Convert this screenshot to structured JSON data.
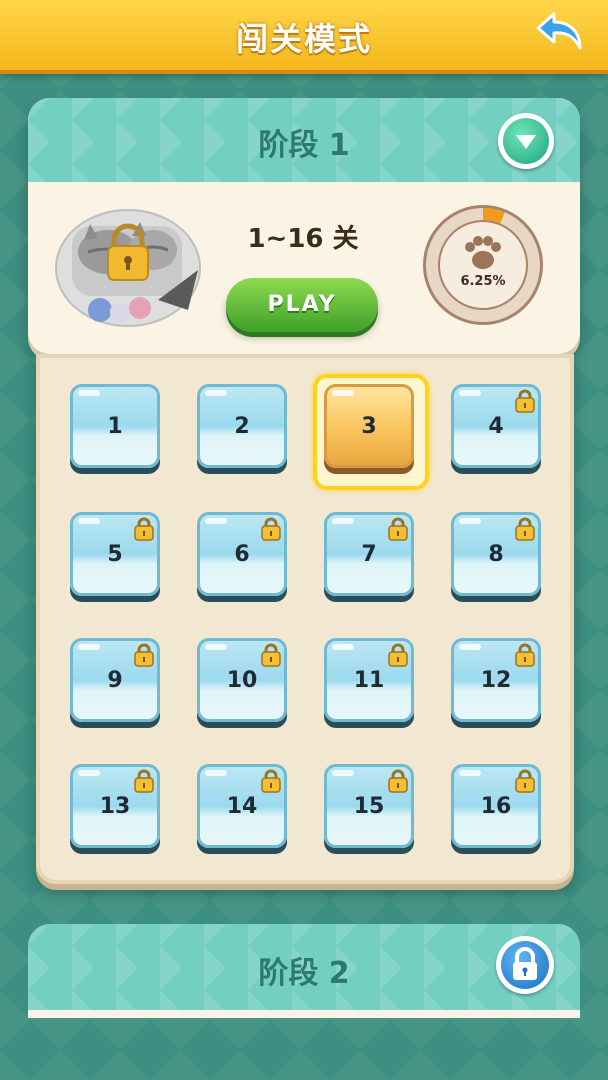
{
  "header": {
    "title": "闯关模式"
  },
  "stage1": {
    "title": "阶段 1",
    "range_label": "1~16 关",
    "play_label": "PLAY",
    "progress_text": "6.25%",
    "progress_fraction": 0.0625,
    "levels": [
      {
        "num": "1",
        "locked": false
      },
      {
        "num": "2",
        "locked": false
      },
      {
        "num": "3",
        "locked": false,
        "current": true
      },
      {
        "num": "4",
        "locked": true
      },
      {
        "num": "5",
        "locked": true
      },
      {
        "num": "6",
        "locked": true
      },
      {
        "num": "7",
        "locked": true
      },
      {
        "num": "8",
        "locked": true
      },
      {
        "num": "9",
        "locked": true
      },
      {
        "num": "10",
        "locked": true
      },
      {
        "num": "11",
        "locked": true
      },
      {
        "num": "12",
        "locked": true
      },
      {
        "num": "13",
        "locked": true
      },
      {
        "num": "14",
        "locked": true
      },
      {
        "num": "15",
        "locked": true
      },
      {
        "num": "16",
        "locked": true
      }
    ]
  },
  "stage2": {
    "title": "阶段 2"
  },
  "icons": {
    "back": "back-arrow-icon",
    "collapse": "chevron-down-icon",
    "paw": "paw-icon",
    "lock": "lock-icon"
  },
  "colors": {
    "header": "#f4b71b",
    "teal": "#74cfc3",
    "play_green": "#3fa02a",
    "progress_orange": "#f29a1a"
  }
}
